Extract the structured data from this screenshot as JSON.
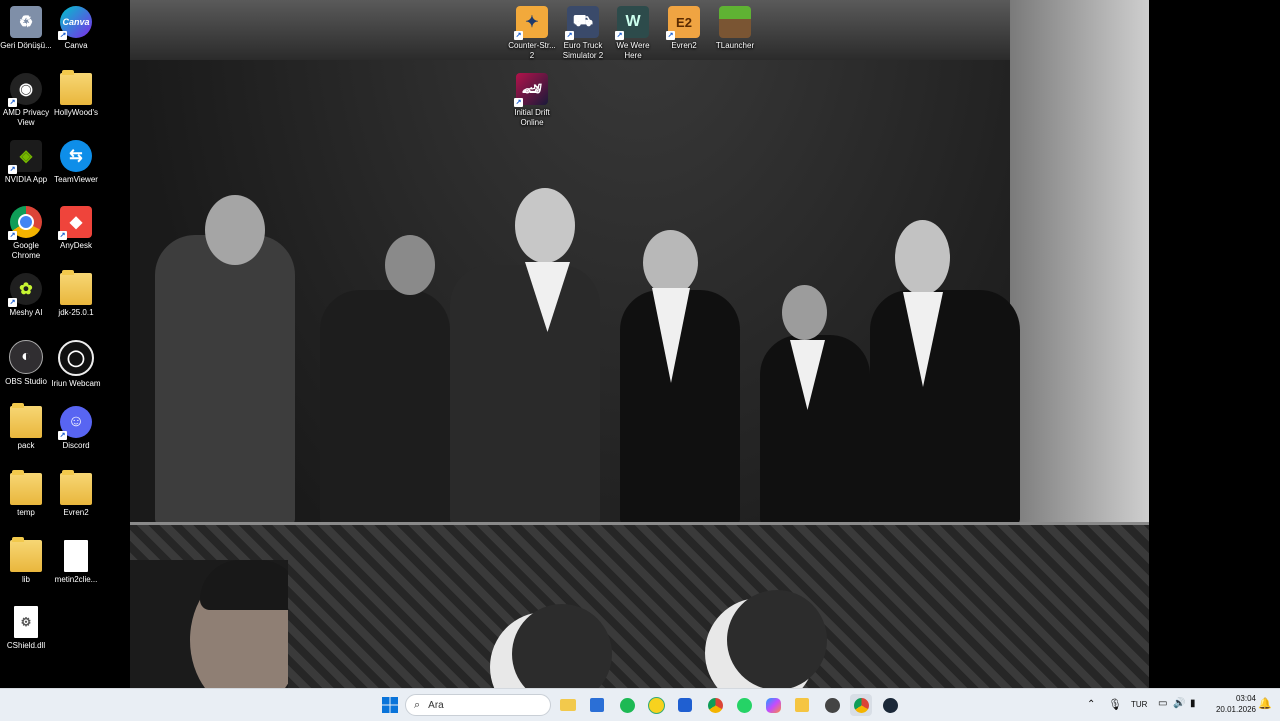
{
  "desktop": {
    "icons": [
      {
        "label": "Geri Dönüşü...",
        "icon": "recycle-bin-icon"
      },
      {
        "label": "Canva",
        "icon": "canva-icon"
      },
      {
        "label": "AMD Privacy View",
        "icon": "amd-privacy-icon"
      },
      {
        "label": "HollyWood's",
        "icon": "folder-icon"
      },
      {
        "label": "NVIDIA App",
        "icon": "nvidia-icon"
      },
      {
        "label": "TeamViewer",
        "icon": "teamviewer-icon"
      },
      {
        "label": "Google Chrome",
        "icon": "chrome-icon"
      },
      {
        "label": "AnyDesk",
        "icon": "anydesk-icon"
      },
      {
        "label": "Meshy AI",
        "icon": "meshy-icon"
      },
      {
        "label": "jdk-25.0.1",
        "icon": "folder-icon"
      },
      {
        "label": "OBS Studio",
        "icon": "obs-icon"
      },
      {
        "label": "Iriun Webcam",
        "icon": "iriun-icon"
      },
      {
        "label": "pack",
        "icon": "folder-icon"
      },
      {
        "label": "Discord",
        "icon": "discord-icon"
      },
      {
        "label": "temp",
        "icon": "folder-icon"
      },
      {
        "label": "Evren2",
        "icon": "folder-icon"
      },
      {
        "label": "lib",
        "icon": "folder-icon"
      },
      {
        "label": "metin2clie...",
        "icon": "file-icon"
      },
      {
        "label": "CShield.dll",
        "icon": "dll-file-icon"
      },
      {
        "label": "Counter-Str... 2",
        "icon": "cs2-icon"
      },
      {
        "label": "Euro Truck Simulator 2",
        "icon": "ets2-icon"
      },
      {
        "label": "We Were Here",
        "icon": "wewerehere-icon"
      },
      {
        "label": "Evren2",
        "icon": "evren2-game-icon"
      },
      {
        "label": "TLauncher",
        "icon": "tlauncher-icon"
      },
      {
        "label": "Initial Drift Online",
        "icon": "initial-drift-icon"
      }
    ]
  },
  "taskbar": {
    "search_placeholder": "Ara",
    "language": "TUR",
    "time": "03:04",
    "date": "20.01.2026",
    "pinned": [
      "start-icon",
      "search-icon",
      "file-explorer-icon",
      "store-icon",
      "spotify-icon",
      "app-icon",
      "app-icon",
      "chrome-icon",
      "whatsapp-icon",
      "copilot-icon",
      "app-icon",
      "app-icon",
      "chrome-icon",
      "steam-icon"
    ]
  }
}
